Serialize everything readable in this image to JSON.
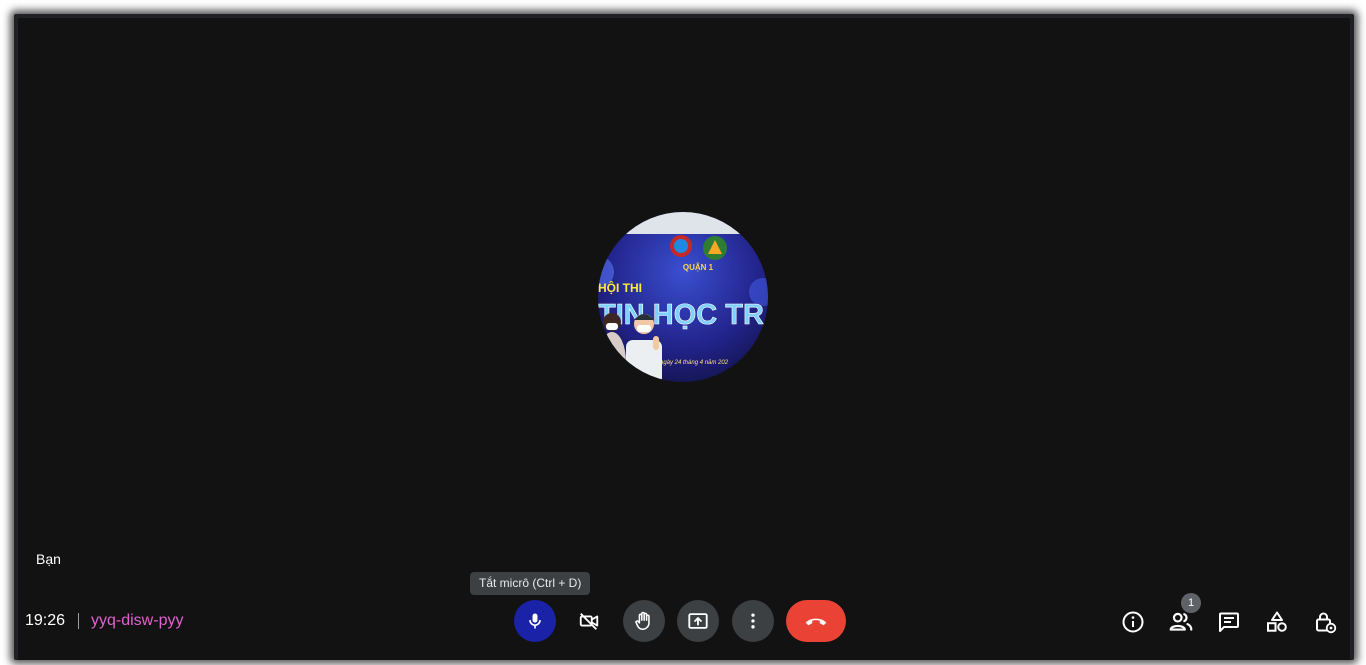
{
  "self_tile": {
    "label": "Bạn",
    "avatar_text": {
      "district": "QUẬN 1",
      "event_line1": "HỘI THI",
      "event_line2": "TIN HỌC TR",
      "date_fragment": "ngày 24 tháng 4 năm 202"
    }
  },
  "meeting": {
    "time": "19:26",
    "code": "yyq-disw-pyy"
  },
  "tooltip": {
    "text": "Tắt micrô (Ctrl + D)"
  },
  "controls": [
    {
      "name": "microphone",
      "icon": "microphone-icon",
      "state": "on"
    },
    {
      "name": "camera",
      "icon": "camera-off-icon",
      "state": "off"
    },
    {
      "name": "raise-hand",
      "icon": "hand-icon"
    },
    {
      "name": "present",
      "icon": "present-screen-icon"
    },
    {
      "name": "more-options",
      "icon": "more-vert-icon"
    },
    {
      "name": "leave-call",
      "icon": "hangup-icon"
    }
  ],
  "right_panel": {
    "participants_count": "1",
    "icons": [
      "info-icon",
      "people-icon",
      "chat-icon",
      "activities-icon",
      "host-controls-icon"
    ]
  },
  "colors": {
    "stage_bg": "#121212",
    "mic_active": "#1a22a8",
    "hangup": "#ea4335",
    "meeting_code": "#e062cf"
  }
}
